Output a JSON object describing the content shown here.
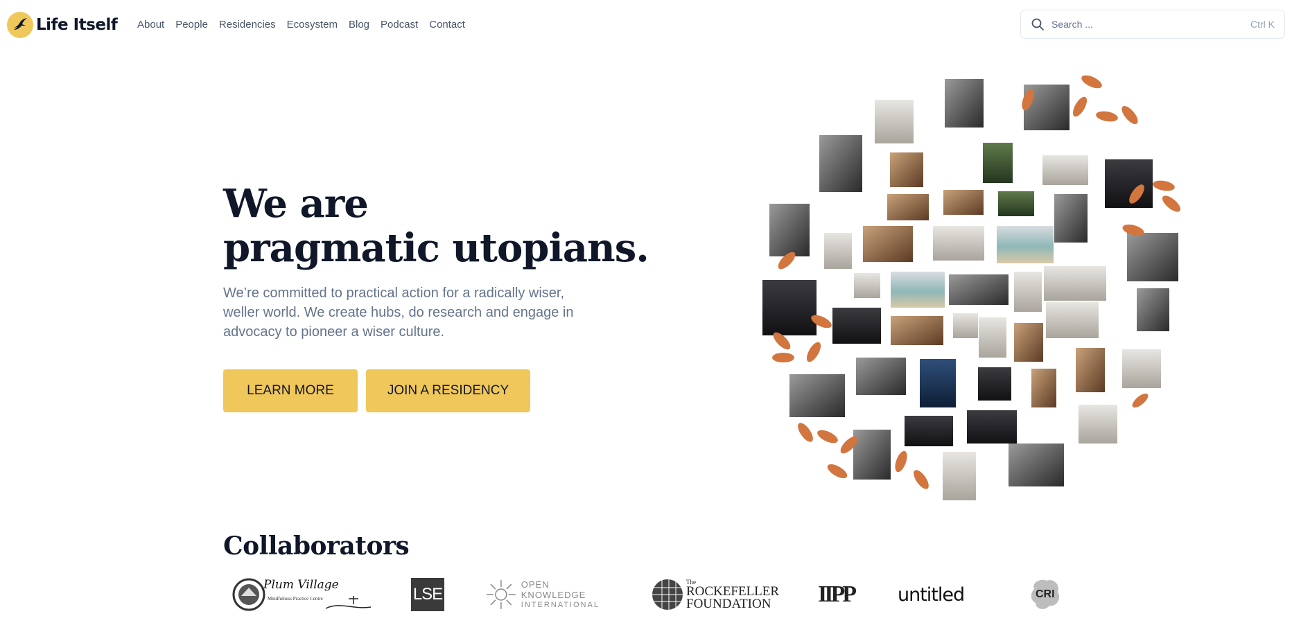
{
  "brand": {
    "name": "Life Itself",
    "logo_icon": "swallow-bird-icon"
  },
  "nav": {
    "links": [
      "About",
      "People",
      "Residencies",
      "Ecosystem",
      "Blog",
      "Podcast",
      "Contact"
    ]
  },
  "search": {
    "placeholder": "Search ...",
    "shortcut": "Ctrl K",
    "icon": "search-icon"
  },
  "hero": {
    "title_line1": "We are",
    "title_line2": "pragmatic utopians.",
    "subtitle": "We’re committed to practical action for a radically wiser, weller world. We create hubs, do research and engage in advocacy to pioneer a wiser culture.",
    "primary_button": "LEARN MORE",
    "secondary_button": "JOIN A RESIDENCY"
  },
  "collaborators": {
    "title": "Collaborators",
    "logos": {
      "plum_village_name": "Plum Village",
      "plum_village_tagline": "Mindfulness Practice Centre",
      "lse": "LSE",
      "okf_line1": "OPEN KNOWLEDGE",
      "okf_line2": "INTERNATIONAL",
      "rockefeller_the": "The",
      "rockefeller_line1": "ROCKEFELLER",
      "rockefeller_line2": "FOUNDATION",
      "iipp": "IIPP",
      "untitled": "untitled",
      "cri": "CRI"
    }
  },
  "colors": {
    "accent": "#f0c75a",
    "heading": "#0f1729",
    "body_text": "#64748b",
    "nav_text": "#475569",
    "leaf": "#d2753f",
    "border": "#e2e8f0"
  }
}
